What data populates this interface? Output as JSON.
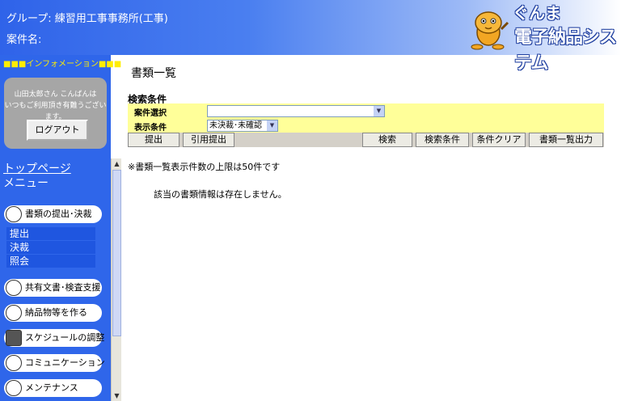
{
  "header": {
    "group": "グループ: 練習用工事事務所(工事)",
    "case": "案件名:",
    "logo_top": "ぐんま",
    "logo_bottom": "電子納品システム"
  },
  "sidebar": {
    "info": "■■■インフォメーション■■■",
    "greet_line1": "山田太郎さん こんばんは",
    "greet_line2": "いつもご利用頂き有難うございます。",
    "logout": "ログアウト",
    "top_page": "トップページ",
    "menu": "メニュー",
    "items": [
      {
        "label": "書類の提出･決裁",
        "icon": "document-icon"
      },
      {
        "label": "共有文書･検査支援",
        "icon": "document-icon"
      },
      {
        "label": "納品物等を作る",
        "icon": "folder-icon"
      },
      {
        "label": "スケジュールの調整",
        "icon": "calendar-icon"
      },
      {
        "label": "コミュニケーション",
        "icon": "mail-icon"
      },
      {
        "label": "メンテナンス",
        "icon": "wrench-icon"
      }
    ],
    "subitems": [
      "提出",
      "決裁",
      "照会"
    ]
  },
  "main": {
    "title": "書類一覧",
    "search_title": "検索条件",
    "case_select_label": "案件選択",
    "case_select_value": "",
    "display_label": "表示条件",
    "display_value": "未決裁･未確認",
    "buttons": {
      "submit": "提出",
      "cite": "引用提出",
      "search": "検索",
      "search_cond": "検索条件",
      "clear": "条件クリア",
      "output": "書類一覧出力"
    },
    "note": "※書類一覧表示件数の上限は50件です",
    "nodata": "該当の書類情報は存在しません。"
  },
  "colors": {
    "sidebar": "#2f66ea",
    "condition_bg": "#ffff99",
    "info_text": "#ffee00"
  }
}
